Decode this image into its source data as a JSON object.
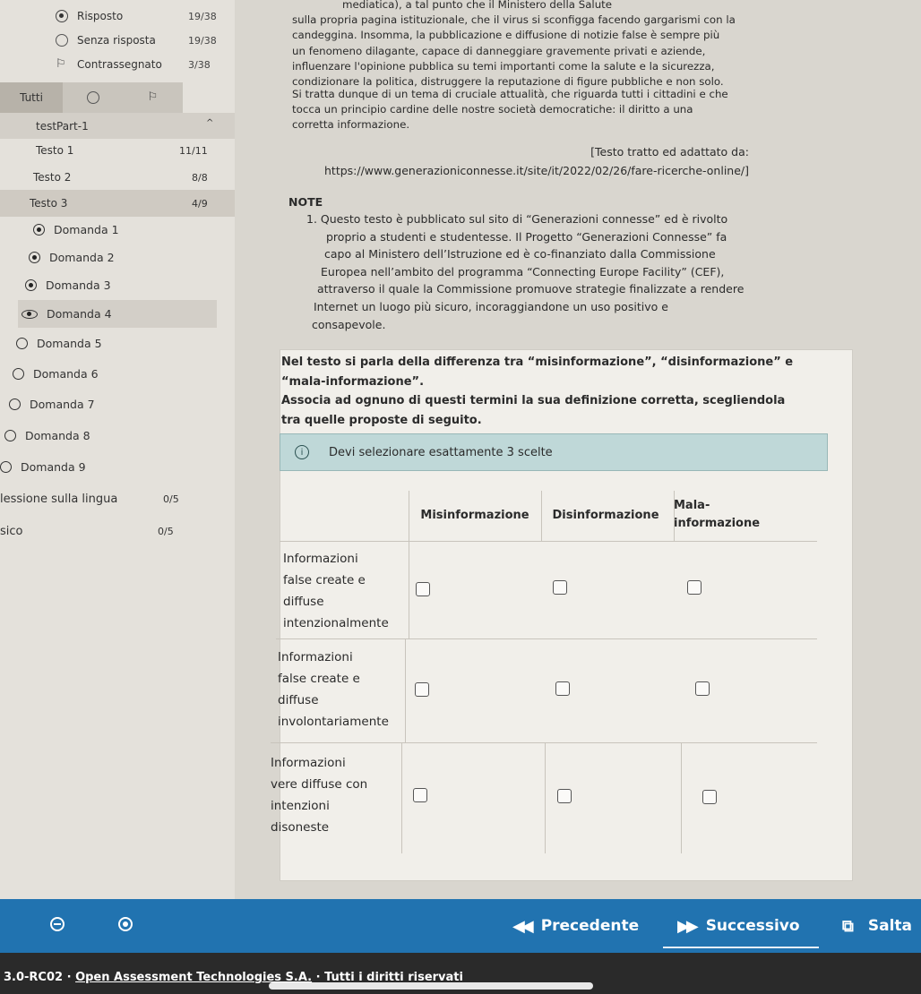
{
  "legend": {
    "answered": {
      "label": "Risposto",
      "count": "19/38"
    },
    "unanswered": {
      "label": "Senza risposta",
      "count": "19/38"
    },
    "flagged": {
      "label": "Contrassegnato",
      "count": "3/38"
    }
  },
  "filter_tabs": {
    "all_label": "Tutti"
  },
  "test_part": {
    "label": "testPart-1",
    "caret": "^"
  },
  "sections": [
    {
      "label": "Testo 1",
      "count": "11/11"
    },
    {
      "label": "Testo 2",
      "count": "8/8"
    },
    {
      "label": "Testo 3",
      "count": "4/9"
    }
  ],
  "items": [
    {
      "label": "Domanda 1"
    },
    {
      "label": "Domanda 2"
    },
    {
      "label": "Domanda 3"
    },
    {
      "label": "Domanda 4"
    },
    {
      "label": "Domanda 5"
    },
    {
      "label": "Domanda 6"
    },
    {
      "label": "Domanda 7"
    },
    {
      "label": "Domanda 8"
    },
    {
      "label": "Domanda 9"
    }
  ],
  "sub_sections": [
    {
      "label": "lessione sulla lingua",
      "count": "0/5"
    },
    {
      "label": "sico",
      "count": "0/5"
    }
  ],
  "passage": {
    "p1_lines": [
      "mediatica), a tal punto che il Ministero della Salute",
      "sulla propria pagina istituzionale, che il virus si sconfigga facendo gargarismi con la",
      "candeggina. Insomma, la pubblicazione e diffusione di notizie false è sempre più",
      "un fenomeno dilagante, capace di danneggiare gravemente privati e aziende,",
      "influenzare l'opinione pubblica su temi importanti come la salute e la sicurezza,",
      "condizionare la politica, distruggere la reputazione di figure pubbliche e non solo."
    ],
    "p2_lines": [
      "Si tratta dunque di un tema di cruciale attualità, che riguarda tutti i cittadini e che",
      "tocca un principio cardine delle nostre società democratiche: il diritto a una",
      "corretta informazione."
    ],
    "credit_line1": "[Testo tratto ed adattato da:",
    "credit_line2": "https://www.generazioniconnesse.it/site/it/2022/02/26/fare-ricerche-online/]",
    "note_heading": "NOTE",
    "note_lines": [
      "1. Questo testo è pubblicato sul sito di “Generazioni connesse” ed è rivolto",
      "proprio a studenti e studentesse. Il Progetto “Generazioni Connesse” fa",
      "capo al Ministero dell’Istruzione ed è co-finanziato dalla Commissione",
      "Europea nell’ambito del programma “Connecting Europe Facility” (CEF),",
      "attraverso il quale la Commissione promuove strategie finalizzate a rendere",
      "Internet un luogo più sicuro, incoraggiandone un uso positivo e",
      "consapevole."
    ]
  },
  "question": {
    "lines": [
      "Nel testo si parla della differenza tra “misinformazione”, “disinformazione” e",
      "“mala-informazione”.",
      "Associa ad ognuno di questi termini la sua definizione corretta, scegliendola",
      "tra quelle proposte di seguito."
    ],
    "info_message": "Devi selezionare esattamente 3 scelte",
    "columns": [
      "Misinformazione",
      "Disinformazione",
      "Mala-\ninformazione"
    ],
    "rows": [
      {
        "label": "Informazioni\nfalse create e\ndiffuse\nintenzionalmente"
      },
      {
        "label": "Informazioni\nfalse create e\ndiffuse\ninvolontariamente"
      },
      {
        "label": "Informazioni\nvere diffuse con\nintenzioni\ndisoneste"
      }
    ]
  },
  "nav": {
    "previous_label": "Precedente",
    "next_label": "Successivo",
    "skip_label": "Salta"
  },
  "footer": {
    "version": "3.0-RC02 · ",
    "company": "Open Assessment Technologies S.A.",
    "rights": " · Tutti i diritti riservati"
  },
  "colors": {
    "nav_bar": "#2173b0",
    "info_box": "#bfd8d8",
    "footer": "#2a2a2a"
  }
}
